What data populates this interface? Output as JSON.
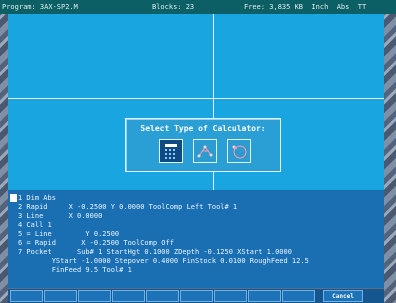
{
  "titlebar": {
    "program": "Program: 3AX-SP2.M",
    "blocks": "Blocks: 23",
    "free": "Free: 3,835 KB  Inch  Abs  TT"
  },
  "dialog": {
    "title": "Select Type of Calculator:",
    "buttons": [
      {
        "name": "basic-calculator",
        "icon": "grid-calculator-icon"
      },
      {
        "name": "geometry-calculator",
        "icon": "geometry-points-icon"
      },
      {
        "name": "circle-calculator",
        "icon": "circle-point-icon"
      }
    ]
  },
  "program": {
    "lines": [
      "1 Dim Abs",
      "2 Rapid     X -0.2500 Y 0.0000 ToolComp Left Tool# 1",
      "3 Line      X 0.0000",
      "4 Call 1",
      "5 = Line        Y 0.2500",
      "6 = Rapid      X -0.2500 ToolComp Off",
      "7 Pocket      Sub# 1 StartHgt 0.1000 ZDepth -0.1250 XStart 1.0000",
      "        YStart -1.0000 Stepover 0.4000 FinStock 0.0100 RoughFeed 12.5",
      "        FinFeed 9.5 Tool# 1"
    ]
  },
  "softkeys": {
    "cancel": "Cancel"
  },
  "colors": {
    "viewport": "#19a6e0",
    "program_bg": "#1a6fb3",
    "titlebar": "#0d5f66"
  }
}
